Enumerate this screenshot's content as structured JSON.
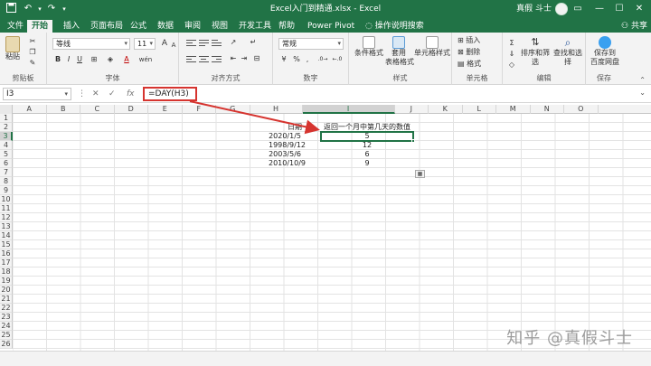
{
  "window": {
    "title": "Excel入门到精通.xlsx  -  Excel",
    "user": "真假 斗士",
    "controls": {
      "restore": "▭",
      "minimize": "—",
      "maximize": "☐",
      "close": "✕"
    },
    "quick_access": {
      "save_icon": "save-icon",
      "undo_icon": "undo-icon",
      "redo_icon": "redo-icon",
      "customize_icon": "customize-icon"
    }
  },
  "tabs": [
    "文件",
    "开始",
    "插入",
    "页面布局",
    "公式",
    "数据",
    "审阅",
    "视图",
    "开发工具",
    "帮助",
    "Power Pivot"
  ],
  "active_tab": "开始",
  "tellme": "操作说明搜索",
  "share": "共享",
  "ribbon": {
    "clipboard": {
      "paste": "粘贴",
      "label": "剪贴板"
    },
    "font": {
      "name": "等线",
      "size": "11",
      "bold": "B",
      "italic": "I",
      "underline": "U",
      "label": "字体",
      "grow": "A",
      "shrink": "A",
      "color_a": "A",
      "wen": "wén"
    },
    "alignment": {
      "label": "对齐方式"
    },
    "number": {
      "format": "常规",
      "percent": "%",
      "comma": ",",
      "label": "数字"
    },
    "styles": {
      "conditional": "条件格式",
      "table": "套用\n表格格式",
      "cell_styles": "单元格样式",
      "label": "样式"
    },
    "cells": {
      "insert": "插入",
      "delete": "删除",
      "format": "格式",
      "label": "单元格"
    },
    "editing": {
      "sort": "排序和筛选",
      "find": "查找和选择",
      "label": "编辑"
    },
    "save": {
      "baidu": "保存到\n百度网盘",
      "label": "保存"
    }
  },
  "formula_bar": {
    "name_box": "I3",
    "cancel": "✕",
    "confirm": "✓",
    "fx": "fx",
    "formula": "=DAY(H3)"
  },
  "columns": [
    "A",
    "B",
    "C",
    "D",
    "E",
    "F",
    "G",
    "H",
    "I",
    "J",
    "K",
    "L",
    "M",
    "N",
    "O"
  ],
  "rows": [
    "1",
    "2",
    "3",
    "4",
    "5",
    "6",
    "7",
    "8",
    "9",
    "10",
    "11",
    "12",
    "13",
    "14",
    "15",
    "16",
    "17",
    "18",
    "19",
    "20",
    "21",
    "22",
    "23",
    "24",
    "25",
    "26"
  ],
  "selected_cell": "I3",
  "sheet": {
    "H2": "日期",
    "I2": "返回一个月中第几天的数值",
    "dates": [
      "2020/1/5",
      "1998/9/12",
      "2003/5/6",
      "2010/10/9"
    ],
    "days": [
      "5",
      "12",
      "6",
      "9"
    ]
  },
  "accent_color": "#217346",
  "highlight_color": "#d6342f",
  "watermark": "知乎 @真假斗士"
}
